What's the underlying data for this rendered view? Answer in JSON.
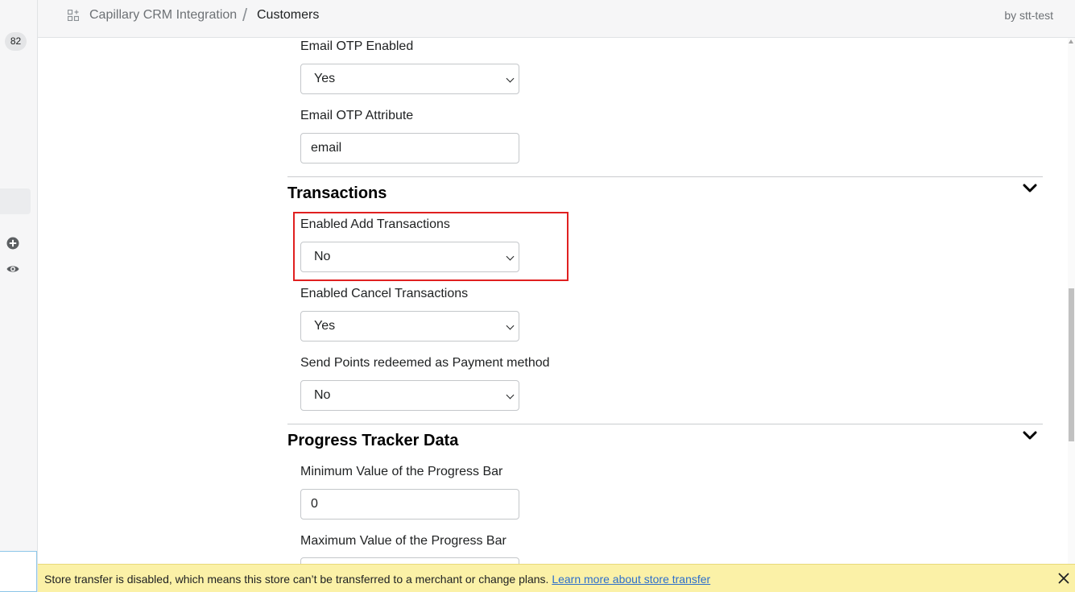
{
  "header": {
    "app_name": "Capillary CRM Integration",
    "separator": "/",
    "page_name": "Customers",
    "byline": "by stt-test"
  },
  "sidebar": {
    "badge": "82",
    "icons": [
      "apps-icon",
      "plus-circle-icon",
      "eye-icon"
    ]
  },
  "fields": {
    "email_otp_enabled": {
      "label": "Email OTP Enabled",
      "value": "Yes"
    },
    "email_otp_attribute": {
      "label": "Email OTP Attribute",
      "value": "email"
    },
    "enabled_add_transactions": {
      "label": "Enabled Add Transactions",
      "value": "No"
    },
    "enabled_cancel_transactions": {
      "label": "Enabled Cancel Transactions",
      "value": "Yes"
    },
    "send_points_redeemed": {
      "label": "Send Points redeemed as Payment method",
      "value": "No"
    },
    "progress_min": {
      "label": "Minimum Value of the Progress Bar",
      "value": "0"
    },
    "progress_max": {
      "label": "Maximum Value of the Progress Bar",
      "value": ""
    }
  },
  "sections": {
    "transactions": "Transactions",
    "progress_tracker": "Progress Tracker Data"
  },
  "banner": {
    "text": "Store transfer is disabled, which means this store can’t be transferred to a merchant or change plans.",
    "link": "Learn more about store transfer"
  },
  "colors": {
    "highlight": "#e02020",
    "banner_bg": "#fbf1a7",
    "link": "#2c6ecb"
  }
}
